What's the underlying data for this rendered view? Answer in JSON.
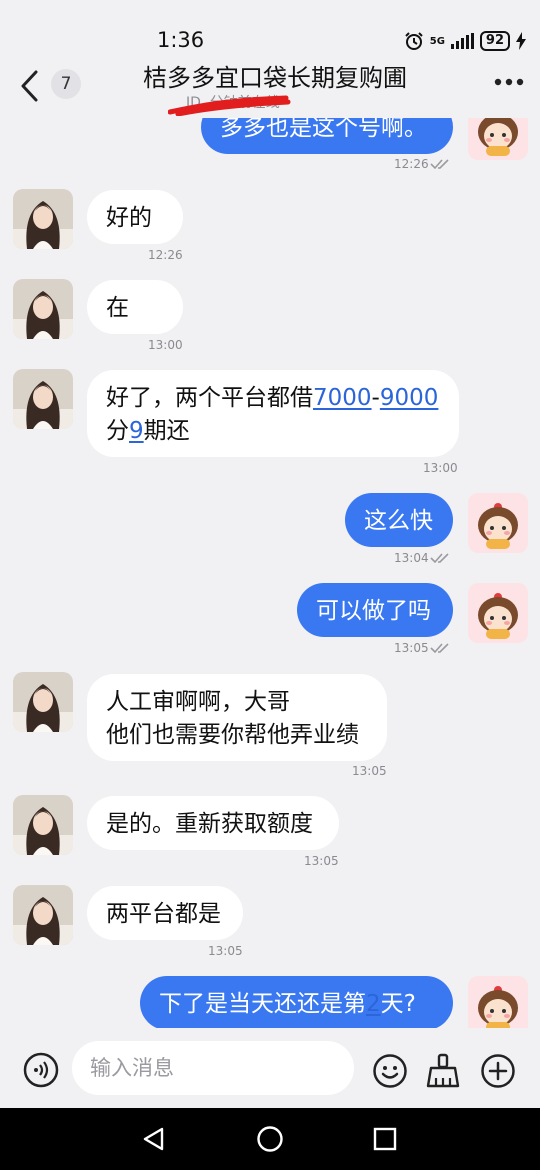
{
  "status": {
    "time": "1:36",
    "network": "5G",
    "battery": "92"
  },
  "header": {
    "unread_count": "7",
    "title": "桔多多宜口袋长期复购圃",
    "subtitle": "ID.                 分钟前在线"
  },
  "messages": [
    {
      "dir": "out",
      "text": "多多也是这个号啊。",
      "time": "12:26",
      "read": true
    },
    {
      "dir": "in",
      "text": "好的",
      "time": "12:26"
    },
    {
      "dir": "in",
      "text": "在",
      "time": "13:00"
    },
    {
      "dir": "in",
      "lines": [
        [
          {
            "t": "好了，两个平台都借"
          },
          {
            "t": "7000",
            "link": true
          },
          {
            "t": "-"
          },
          {
            "t": "9000",
            "link": true
          }
        ],
        [
          {
            "t": "分"
          },
          {
            "t": "9",
            "link": true
          },
          {
            "t": "期还"
          }
        ]
      ],
      "time": "13:00"
    },
    {
      "dir": "out",
      "text": "这么快",
      "time": "13:04",
      "read": true
    },
    {
      "dir": "out",
      "text": "可以做了吗",
      "time": "13:05",
      "read": true
    },
    {
      "dir": "in",
      "lines": [
        [
          {
            "t": "人工审啊啊，大哥"
          }
        ],
        [
          {
            "t": "他们也需要你帮他弄业绩"
          }
        ]
      ],
      "time": "13:05"
    },
    {
      "dir": "in",
      "text": "是的。重新获取额度",
      "time": "13:05"
    },
    {
      "dir": "in",
      "text": "两平台都是",
      "time": "13:05"
    },
    {
      "dir": "out",
      "lines": [
        [
          {
            "t": "下了是当天还还是第"
          },
          {
            "t": "2",
            "link": true
          },
          {
            "t": "天?"
          }
        ]
      ]
    }
  ],
  "input": {
    "placeholder": "输入消息"
  },
  "colors": {
    "accent": "#3a78f2",
    "background": "#f1f1f3",
    "link": "#2b65d9"
  },
  "icons": [
    "back-arrow-icon",
    "more-icon",
    "voice-icon",
    "emoji-icon",
    "broom-icon",
    "plus-icon",
    "nav-back-icon",
    "nav-home-icon",
    "nav-recent-icon",
    "double-check-icon"
  ]
}
